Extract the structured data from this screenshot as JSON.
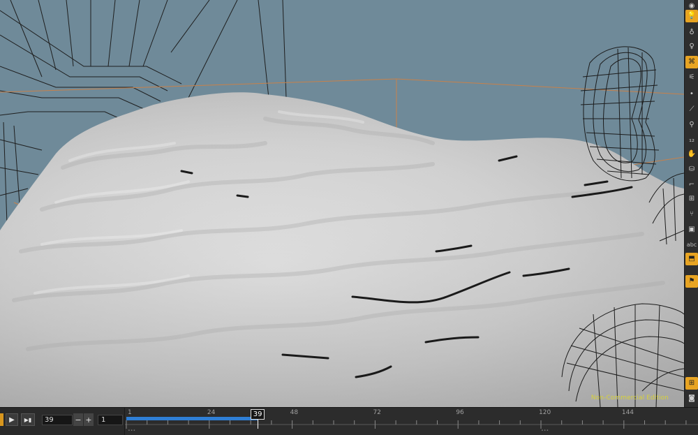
{
  "viewport": {
    "watermark": "Non-Commercial Edition"
  },
  "shelf": {
    "tools": [
      {
        "name": "select-tool",
        "icon": "select-icon",
        "glyph": "◉",
        "active": false
      },
      {
        "name": "light-tool",
        "icon": "light-bulb-icon",
        "glyph": "💡",
        "active": true
      },
      {
        "name": "view-light-tool",
        "icon": "light-icon",
        "glyph": "♁",
        "active": false
      },
      {
        "name": "handle-tool",
        "icon": "handle-icon",
        "glyph": "♀",
        "active": false
      },
      {
        "name": "snap-tool",
        "icon": "snap-icon",
        "glyph": "⌘",
        "active": true
      },
      {
        "name": "camera-tool",
        "icon": "camera-icon",
        "glyph": "⚟",
        "active": false
      },
      {
        "name": "point-tool",
        "icon": "point-icon",
        "glyph": "•",
        "active": false
      },
      {
        "name": "edge-tool",
        "icon": "edge-icon",
        "glyph": "⟋",
        "active": false
      },
      {
        "name": "pin-tool",
        "icon": "pin-icon",
        "glyph": "⚲",
        "active": false
      },
      {
        "name": "number-tool",
        "icon": "number-icon",
        "glyph": "₁₂",
        "active": false
      },
      {
        "name": "hand-tool",
        "icon": "hand-icon",
        "glyph": "✋",
        "active": false
      },
      {
        "name": "stamp-tool",
        "icon": "stamp-icon",
        "glyph": "⛁",
        "active": false
      },
      {
        "name": "corner-tool",
        "icon": "corner-icon",
        "glyph": "⌐",
        "active": false
      },
      {
        "name": "grid-tool",
        "icon": "grid-icon",
        "glyph": "⊞",
        "active": false
      },
      {
        "name": "node-tool",
        "icon": "node-icon",
        "glyph": "⑂",
        "active": false
      },
      {
        "name": "box-tool",
        "icon": "box-icon",
        "glyph": "▣",
        "active": false
      },
      {
        "name": "text-tool",
        "icon": "text-icon",
        "glyph": "abc",
        "active": false
      },
      {
        "name": "display-tool",
        "icon": "display-icon",
        "glyph": "⬒",
        "active": true
      },
      {
        "name": "marker-tool",
        "icon": "marker-icon",
        "glyph": "⚑",
        "active": true
      },
      {
        "name": "layout-tool",
        "icon": "layout-icon",
        "glyph": "⊞",
        "active": true
      },
      {
        "name": "snapshot-tool",
        "icon": "snapshot-icon",
        "glyph": "◙",
        "active": false
      }
    ]
  },
  "playbar": {
    "play_icon": "▶",
    "next_icon": "▶▮",
    "frame_value": "39",
    "minus_label": "−",
    "plus_label": "+",
    "step_value": "1"
  },
  "timeline": {
    "current_frame": "39",
    "range_start": 1,
    "range_end": 39,
    "visible_end": 164,
    "tick_labels": [
      "1",
      "24",
      "48",
      "72",
      "96",
      "120",
      "144"
    ],
    "tick_values": [
      1,
      24,
      48,
      72,
      96,
      120,
      144
    ],
    "range_color": "#2f7fd6"
  }
}
